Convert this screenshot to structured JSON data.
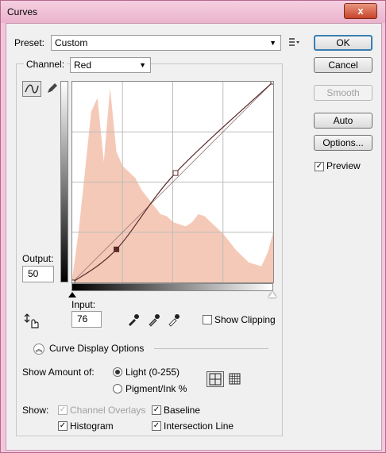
{
  "window": {
    "title": "Curves",
    "close": "x"
  },
  "preset": {
    "label": "Preset:",
    "value": "Custom"
  },
  "channel": {
    "label": "Channel:",
    "value": "Red"
  },
  "output": {
    "label": "Output:",
    "value": "50"
  },
  "input": {
    "label": "Input:",
    "value": "76"
  },
  "buttons": {
    "ok": "OK",
    "cancel": "Cancel",
    "smooth": "Smooth",
    "auto": "Auto",
    "options": "Options..."
  },
  "preview": {
    "label": "Preview",
    "checked": true
  },
  "show_clipping": {
    "label": "Show Clipping",
    "checked": false
  },
  "curve_display": {
    "label": "Curve Display Options"
  },
  "show_amount": {
    "label": "Show Amount of:",
    "light": "Light  (0-255)",
    "pigment": "Pigment/Ink %",
    "selected": "light"
  },
  "show": {
    "label": "Show:",
    "channel_overlays": "Channel Overlays",
    "baseline": "Baseline",
    "histogram": "Histogram",
    "intersection_line": "Intersection Line"
  },
  "icons": {
    "preset_menu": "preset-options-icon",
    "curve_tool": "curve-tool-icon",
    "pencil_tool": "pencil-tool-icon",
    "targeted_adjust": "targeted-adjustment-icon",
    "eyedropper_black": "black-eyedropper-icon",
    "eyedropper_gray": "gray-eyedropper-icon",
    "eyedropper_white": "white-eyedropper-icon",
    "expand": "collapse-chevron-icon",
    "grid_simple": "simple-grid-icon",
    "grid_detailed": "detailed-grid-icon"
  },
  "colors": {
    "histogram": "#f5c9b7",
    "curve": "#5a2a2a",
    "accent": "#3c7fb1"
  },
  "chart_data": {
    "type": "area",
    "x": [
      0,
      8,
      16,
      24,
      32,
      40,
      48,
      56,
      64,
      72,
      80,
      88,
      96,
      104,
      112,
      120,
      128,
      136,
      144,
      152,
      160,
      168,
      176,
      184,
      192,
      200,
      208,
      216,
      224,
      232,
      240,
      248,
      255
    ],
    "values": [
      0.02,
      0.25,
      0.55,
      0.85,
      0.92,
      0.6,
      0.97,
      0.65,
      0.58,
      0.55,
      0.52,
      0.46,
      0.42,
      0.38,
      0.34,
      0.33,
      0.3,
      0.29,
      0.28,
      0.3,
      0.34,
      0.33,
      0.3,
      0.27,
      0.24,
      0.2,
      0.16,
      0.13,
      0.1,
      0.09,
      0.08,
      0.15,
      0.25
    ],
    "curve_points": [
      [
        0,
        0
      ],
      [
        56,
        42
      ],
      [
        131,
        139
      ],
      [
        255,
        255
      ]
    ],
    "xlim": [
      0,
      255
    ],
    "ylim": [
      0,
      255
    ],
    "grid": true
  }
}
